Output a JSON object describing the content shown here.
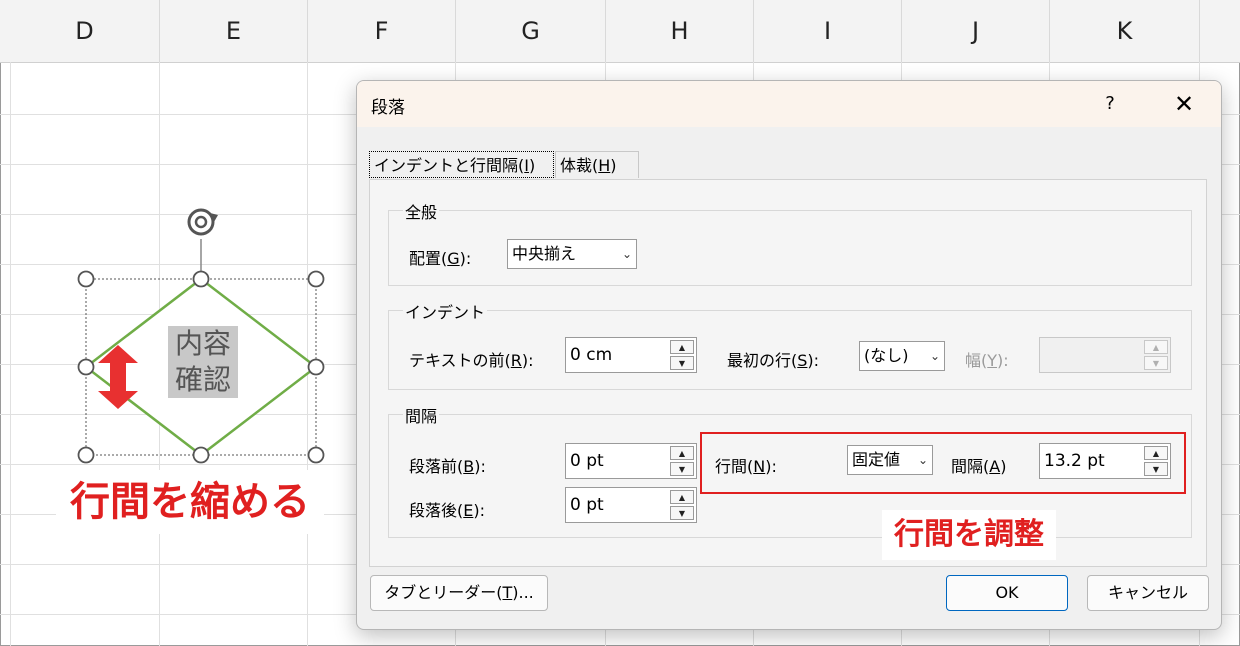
{
  "sheet": {
    "columns": [
      "D",
      "E",
      "F",
      "G",
      "H",
      "I",
      "J",
      "K"
    ]
  },
  "shape": {
    "text_line1": "内容",
    "text_line2": "確認",
    "rotate_icon": "rotate-icon",
    "resize_arrow_icon": "double-arrow-vertical-icon",
    "line_color": "#70ad47",
    "arrow_color": "#e02020"
  },
  "annotations": {
    "left_label": "行間を縮める",
    "right_label": "行間を調整",
    "color": "#e02020"
  },
  "dialog": {
    "title": "段落",
    "help": "?",
    "close": "✕",
    "tabs": [
      {
        "label_prefix": "インデントと行間隔(",
        "key": "I",
        "label_suffix": ")"
      },
      {
        "label_prefix": "体裁(",
        "key": "H",
        "label_suffix": ")"
      }
    ],
    "general": {
      "title": "全般",
      "alignment_label_prefix": "配置(",
      "alignment_key": "G",
      "alignment_label_suffix": "):",
      "alignment_value": "中央揃え"
    },
    "indent": {
      "title": "インデント",
      "before_text_prefix": "テキストの前(",
      "before_text_key": "R",
      "before_text_suffix": "):",
      "before_text_value": "0 cm",
      "first_line_prefix": "最初の行(",
      "first_line_key": "S",
      "first_line_suffix": "):",
      "first_line_value": "(なし)",
      "width_prefix": "幅(",
      "width_key": "Y",
      "width_suffix": "):",
      "width_value": ""
    },
    "spacing": {
      "title": "間隔",
      "before_prefix": "段落前(",
      "before_key": "B",
      "before_suffix": "):",
      "before_value": "0 pt",
      "after_prefix": "段落後(",
      "after_key": "E",
      "after_suffix": "):",
      "after_value": "0 pt",
      "line_prefix": "行間(",
      "line_key": "N",
      "line_suffix": "):",
      "line_value": "固定値",
      "at_prefix": "間隔(",
      "at_key": "A",
      "at_suffix": ")",
      "at_value": "13.2 pt"
    },
    "buttons": {
      "tabs_prefix": "タブとリーダー(",
      "tabs_key": "T",
      "tabs_suffix": ")...",
      "ok": "OK",
      "cancel": "キャンセル"
    }
  }
}
